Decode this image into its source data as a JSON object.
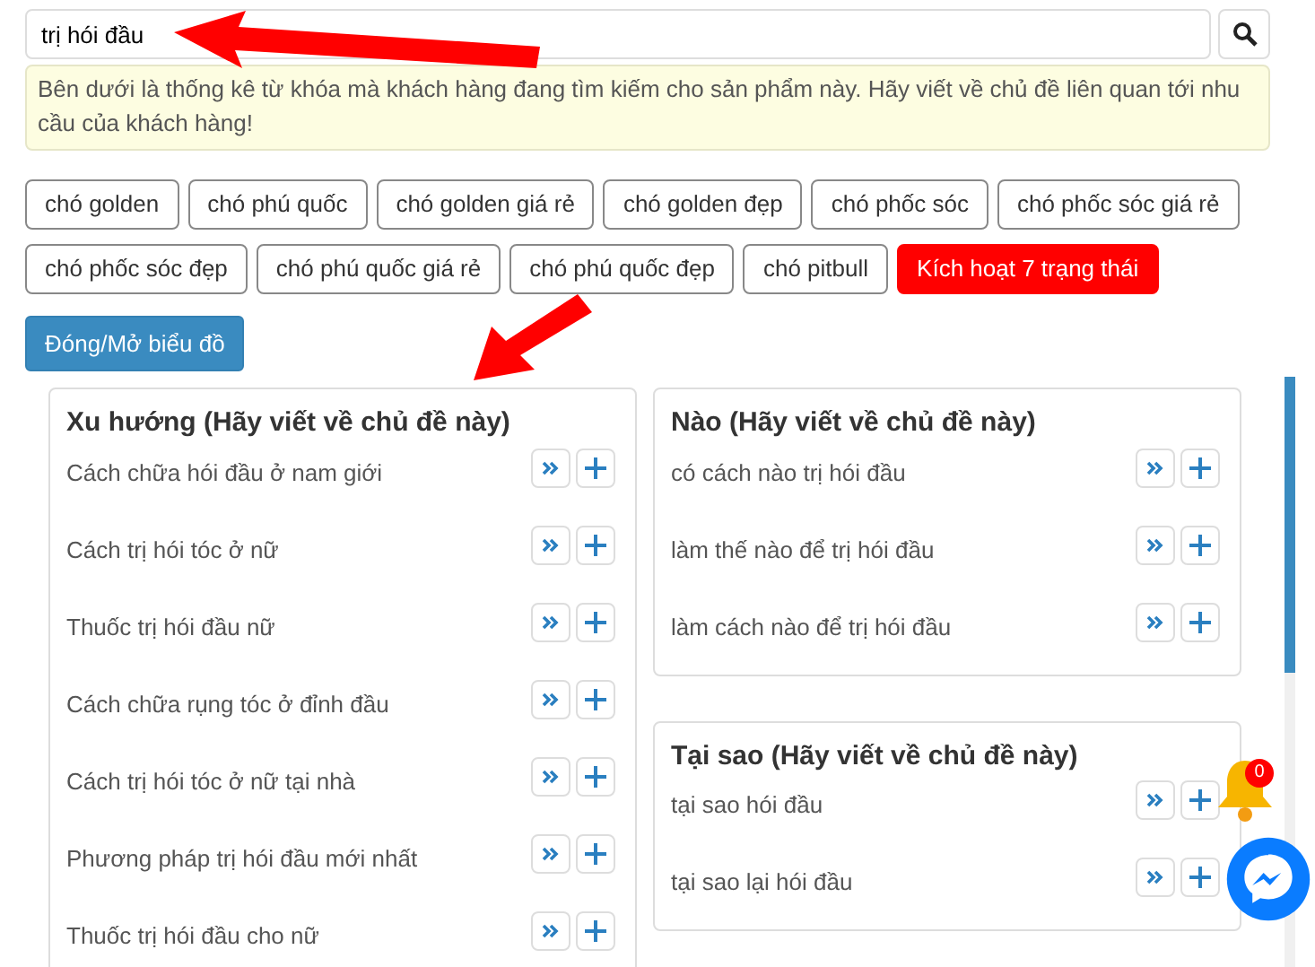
{
  "search": {
    "value": "trị hói đầu"
  },
  "notice": "Bên dưới là thống kê từ khóa mà khách hàng đang tìm kiếm cho sản phẩm này. Hãy viết về chủ đề liên quan tới nhu cầu của khách hàng!",
  "tags": [
    {
      "label": "chó golden",
      "kind": "keyword"
    },
    {
      "label": "chó phú quốc",
      "kind": "keyword"
    },
    {
      "label": "chó golden giá rẻ",
      "kind": "keyword"
    },
    {
      "label": "chó golden đẹp",
      "kind": "keyword"
    },
    {
      "label": "chó phốc sóc",
      "kind": "keyword"
    },
    {
      "label": "chó phốc sóc giá rẻ",
      "kind": "keyword"
    },
    {
      "label": "chó phốc sóc đẹp",
      "kind": "keyword"
    },
    {
      "label": "chó phú quốc giá rẻ",
      "kind": "keyword"
    },
    {
      "label": "chó phú quốc đẹp",
      "kind": "keyword"
    },
    {
      "label": "chó pitbull",
      "kind": "keyword"
    },
    {
      "label": "Kích hoạt 7 trạng thái",
      "kind": "activate"
    }
  ],
  "toggle_button": "Đóng/Mở biểu đồ",
  "groups": [
    {
      "title": "Xu hướng (Hãy viết về chủ đề này)",
      "items": [
        "Cách chữa hói đầu ở nam giới",
        "Cách trị hói tóc ở nữ",
        "Thuốc trị hói đầu nữ",
        "Cách chữa rụng tóc ở đỉnh đầu",
        "Cách trị hói tóc ở nữ tại nhà",
        "Phương pháp trị hói đầu mới nhất",
        "Thuốc trị hói đầu cho nữ"
      ]
    },
    {
      "title": "Nào (Hãy viết về chủ đề này)",
      "items": [
        "có cách nào trị hói đầu",
        "làm thế nào để trị hói đầu",
        "làm cách nào để trị hói đầu"
      ]
    },
    {
      "title": "Tại sao (Hãy viết về chủ đề này)",
      "items": [
        "tại sao hói đầu",
        "tại sao lại hói đầu"
      ]
    }
  ],
  "notification_badge": "0"
}
